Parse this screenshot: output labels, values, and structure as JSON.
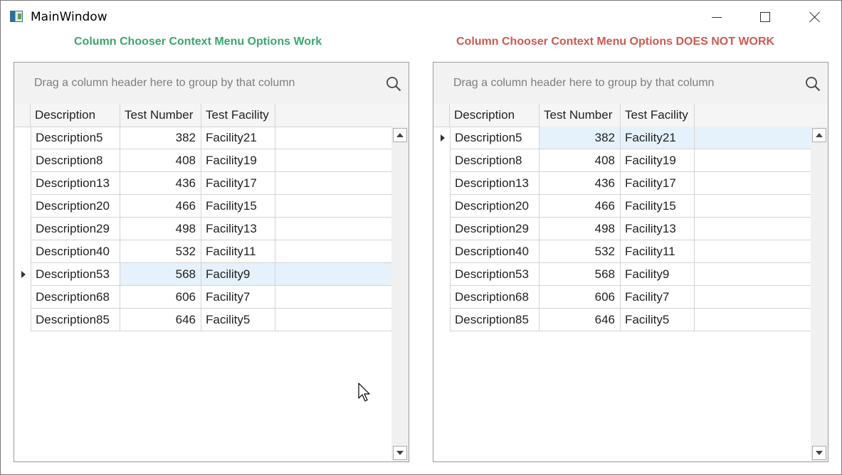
{
  "window": {
    "title": "MainWindow"
  },
  "headings": {
    "left": "Column Chooser Context Menu Options Work",
    "right": "Column Chooser Context Menu Options DOES NOT WORK"
  },
  "colors": {
    "left_heading": "#3aa76d",
    "right_heading": "#cd5a50",
    "current_row": "#e5f1fb"
  },
  "grids": [
    {
      "group_panel_text": "Drag a column header here to group by that column",
      "columns": [
        "Description",
        "Test Number",
        "Test Facility"
      ],
      "current_row_index": 6,
      "rows": [
        {
          "description": "Description5",
          "test_number": "382",
          "test_facility": "Facility21"
        },
        {
          "description": "Description8",
          "test_number": "408",
          "test_facility": "Facility19"
        },
        {
          "description": "Description13",
          "test_number": "436",
          "test_facility": "Facility17"
        },
        {
          "description": "Description20",
          "test_number": "466",
          "test_facility": "Facility15"
        },
        {
          "description": "Description29",
          "test_number": "498",
          "test_facility": "Facility13"
        },
        {
          "description": "Description40",
          "test_number": "532",
          "test_facility": "Facility11"
        },
        {
          "description": "Description53",
          "test_number": "568",
          "test_facility": "Facility9"
        },
        {
          "description": "Description68",
          "test_number": "606",
          "test_facility": "Facility7"
        },
        {
          "description": "Description85",
          "test_number": "646",
          "test_facility": "Facility5"
        }
      ]
    },
    {
      "group_panel_text": "Drag a column header here to group by that column",
      "columns": [
        "Description",
        "Test Number",
        "Test Facility"
      ],
      "current_row_index": 0,
      "rows": [
        {
          "description": "Description5",
          "test_number": "382",
          "test_facility": "Facility21"
        },
        {
          "description": "Description8",
          "test_number": "408",
          "test_facility": "Facility19"
        },
        {
          "description": "Description13",
          "test_number": "436",
          "test_facility": "Facility17"
        },
        {
          "description": "Description20",
          "test_number": "466",
          "test_facility": "Facility15"
        },
        {
          "description": "Description29",
          "test_number": "498",
          "test_facility": "Facility13"
        },
        {
          "description": "Description40",
          "test_number": "532",
          "test_facility": "Facility11"
        },
        {
          "description": "Description53",
          "test_number": "568",
          "test_facility": "Facility9"
        },
        {
          "description": "Description68",
          "test_number": "606",
          "test_facility": "Facility7"
        },
        {
          "description": "Description85",
          "test_number": "646",
          "test_facility": "Facility5"
        }
      ]
    }
  ]
}
